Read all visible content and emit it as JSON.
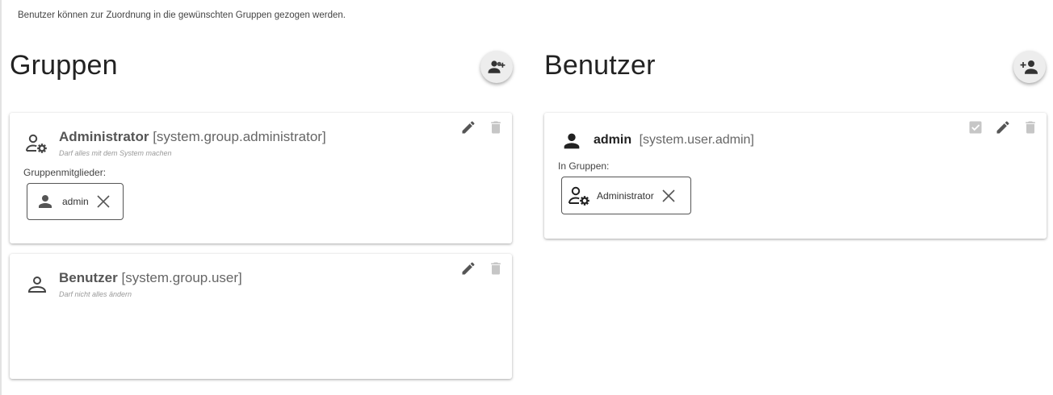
{
  "hint": "Benutzer können zur Zuordnung in die gewünschten Gruppen gezogen werden.",
  "groups_column": {
    "title": "Gruppen",
    "add_icon": "add-group-icon",
    "cards": [
      {
        "name": "Administrator",
        "id_text": "[system.group.administrator]",
        "description": "Darf alles mit dem System machen",
        "icon": "group-settings-icon",
        "members_label": "Gruppenmitglieder:",
        "members": [
          {
            "label": "admin",
            "icon": "person-icon"
          }
        ]
      },
      {
        "name": "Benutzer",
        "id_text": "[system.group.user]",
        "description": "Darf nicht alles ändern",
        "icon": "person-outline-icon"
      }
    ]
  },
  "users_column": {
    "title": "Benutzer",
    "add_icon": "add-user-icon",
    "cards": [
      {
        "name": "admin",
        "id_text": "[system.user.admin]",
        "icon": "person-icon",
        "groups_label": "In Gruppen:",
        "groups": [
          {
            "label": "Administrator",
            "icon": "group-settings-icon"
          }
        ]
      }
    ]
  },
  "colors": {
    "icon": "#555555",
    "icon_muted": "#c6c6c6",
    "fab_bg": "#ededed"
  }
}
